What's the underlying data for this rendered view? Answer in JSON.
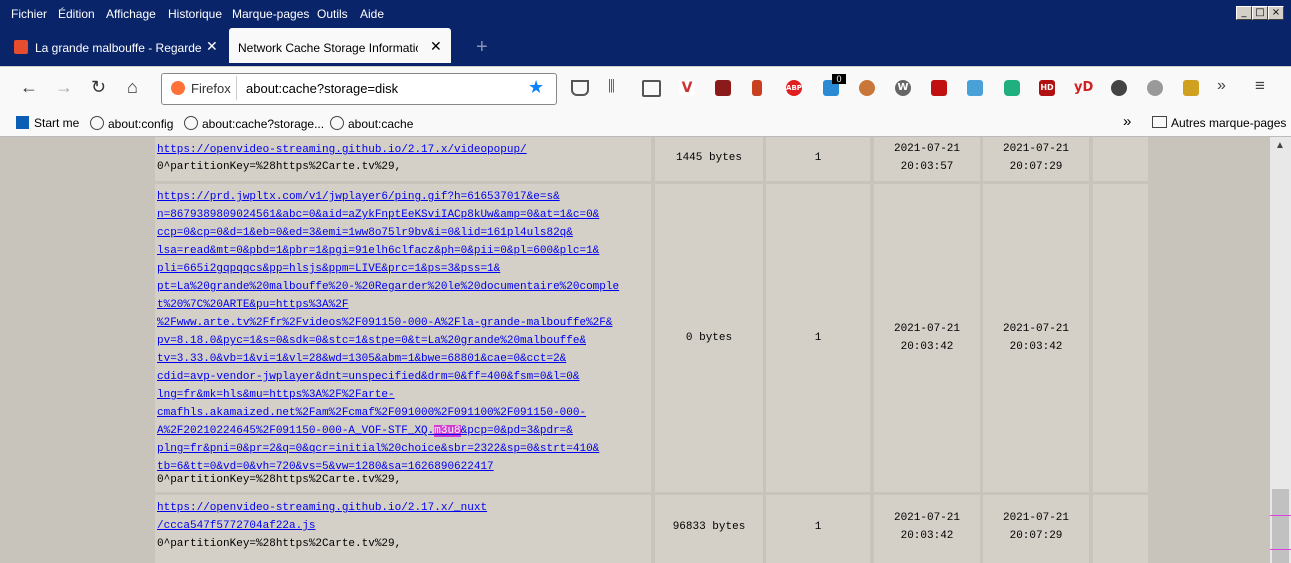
{
  "menu": [
    "Fichier",
    "Édition",
    "Affichage",
    "Historique",
    "Marque-pages",
    "Outils",
    "Aide"
  ],
  "tabs": [
    {
      "label": "La grande malbouffe - Regarder le"
    },
    {
      "label": "Network Cache Storage Information"
    }
  ],
  "url": {
    "identity": "Firefox",
    "value": "about:cache?storage=disk"
  },
  "extensions": [
    "V",
    "ABP",
    "0",
    "yD",
    "HD"
  ],
  "bookmarks": [
    "Start me",
    "about:config",
    "about:cache?storage...",
    "about:cache"
  ],
  "other_bookmarks": "Autres marque-pages",
  "entries": [
    {
      "key_lines": [
        "https://openvideo-streaming.github.io/2.17.x/videopopup/"
      ],
      "partition": "0^partitionKey=%28https%2Carte.tv%29,",
      "size": "1445 bytes",
      "fetch": "1",
      "last_fetched": [
        "2021-07-21",
        "20:03:57"
      ],
      "last_modified": [
        "2021-07-21",
        "20:07:29"
      ]
    },
    {
      "key_lines": [
        "https://prd.jwpltx.com/v1/jwplayer6/ping.gif?h=616537017&e=s&",
        "n=8679389809024561&abc=0&aid=aZykFnptEeKSviIACp8kUw&amp=0&at=1&c=0&",
        "ccp=0&cp=0&d=1&eb=0&ed=3&emi=1ww8o75lr9bv&i=0&lid=161pl4uls82q&",
        "lsa=read&mt=0&pbd=1&pbr=1&pgi=91elh6clfacz&ph=0&pii=0&pl=600&plc=1&",
        "pli=665i2gqpqqcs&pp=hlsjs&ppm=LIVE&prc=1&ps=3&pss=1&",
        "pt=La%20grande%20malbouffe%20-%20Regarder%20le%20documentaire%20comple",
        "t%20%7C%20ARTE&pu=https%3A%2F",
        "%2Fwww.arte.tv%2Ffr%2Fvideos%2F091150-000-A%2Fla-grande-malbouffe%2F&",
        "pv=8.18.0&pyc=1&s=0&sdk=0&stc=1&stpe=0&t=La%20grande%20malbouffe&",
        "tv=3.33.0&vb=1&vi=1&vl=28&wd=1305&abm=1&bwe=68801&cae=0&cct=2&",
        "cdid=avp-vendor-jwplayer&dnt=unspecified&drm=0&ff=400&fsm=0&l=0&",
        "lng=fr&mk=hls&mu=https%3A%2F%2Farte-",
        "cmafhls.akamaized.net%2Fam%2Fcmaf%2F091000%2F091100%2F091150-000-",
        "A%2F20210224645%2F091150-000-A_VOF-STF_XQ.m3u8&pcp=0&pd=3&pdr=&",
        "plng=fr&pni=0&pr=2&q=0&qcr=initial%20choice&sbr=2322&sp=0&strt=410&",
        "tb=6&tt=0&vd=0&vh=720&vs=5&vw=1280&sa=1626890622417"
      ],
      "highlight": "m3u8",
      "partition": "0^partitionKey=%28https%2Carte.tv%29,",
      "size": "0 bytes",
      "fetch": "1",
      "last_fetched": [
        "2021-07-21",
        "20:03:42"
      ],
      "last_modified": [
        "2021-07-21",
        "20:03:42"
      ]
    },
    {
      "key_lines": [
        "https://openvideo-streaming.github.io/2.17.x/_nuxt",
        "/ccca547f5772704af22a.js"
      ],
      "partition": "0^partitionKey=%28https%2Carte.tv%29,",
      "size": "96833 bytes",
      "fetch": "1",
      "last_fetched": [
        "2021-07-21",
        "20:03:42"
      ],
      "last_modified": [
        "2021-07-21",
        "20:07:29"
      ]
    }
  ]
}
